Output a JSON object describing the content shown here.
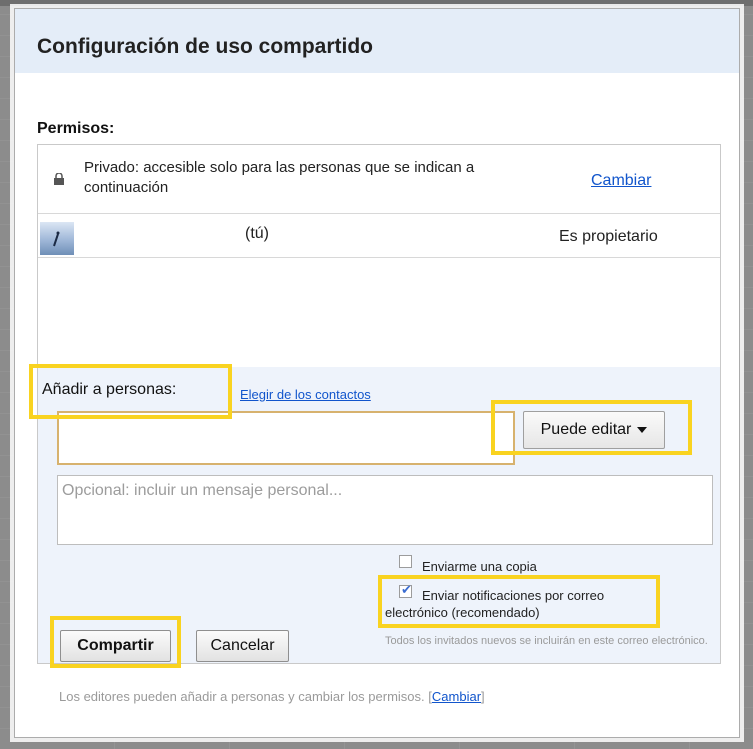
{
  "dialog": {
    "title": "Configuración de uso compartido",
    "permissions_label": "Permisos:",
    "private_text": "Privado: accesible solo para las personas que se indican a continuación",
    "private_change_link": "Cambiar",
    "owner_name": "(tú)",
    "owner_role": "Es propietario",
    "add_people_label": "Añadir a personas:",
    "choose_contacts_link": "Elegir de los contactos",
    "people_input_value": "",
    "role_dropdown_value": "Puede editar",
    "message_placeholder": "Opcional: incluir un mensaje personal...",
    "send_copy_label": "Enviarme una copia",
    "send_copy_checked": false,
    "notify_label_line1": "Enviar notificaciones por correo",
    "notify_label_line2": "electrónico (recomendado)",
    "notify_checked": true,
    "notify_note": "Todos los invitados nuevos se incluirán en este correo electrónico.",
    "share_button": "Compartir",
    "cancel_button": "Cancelar",
    "footer_text": "Los editores pueden añadir a personas y cambiar los permisos.",
    "footer_link": "Cambiar"
  },
  "icons": [
    "lock-icon",
    "avatar",
    "caret-down-icon",
    "checkmark-icon"
  ],
  "colors": {
    "title_bar": "#e4edf8",
    "link": "#1155cc",
    "highlight": "#f9d320",
    "add_section_bg": "#eef3fb"
  }
}
